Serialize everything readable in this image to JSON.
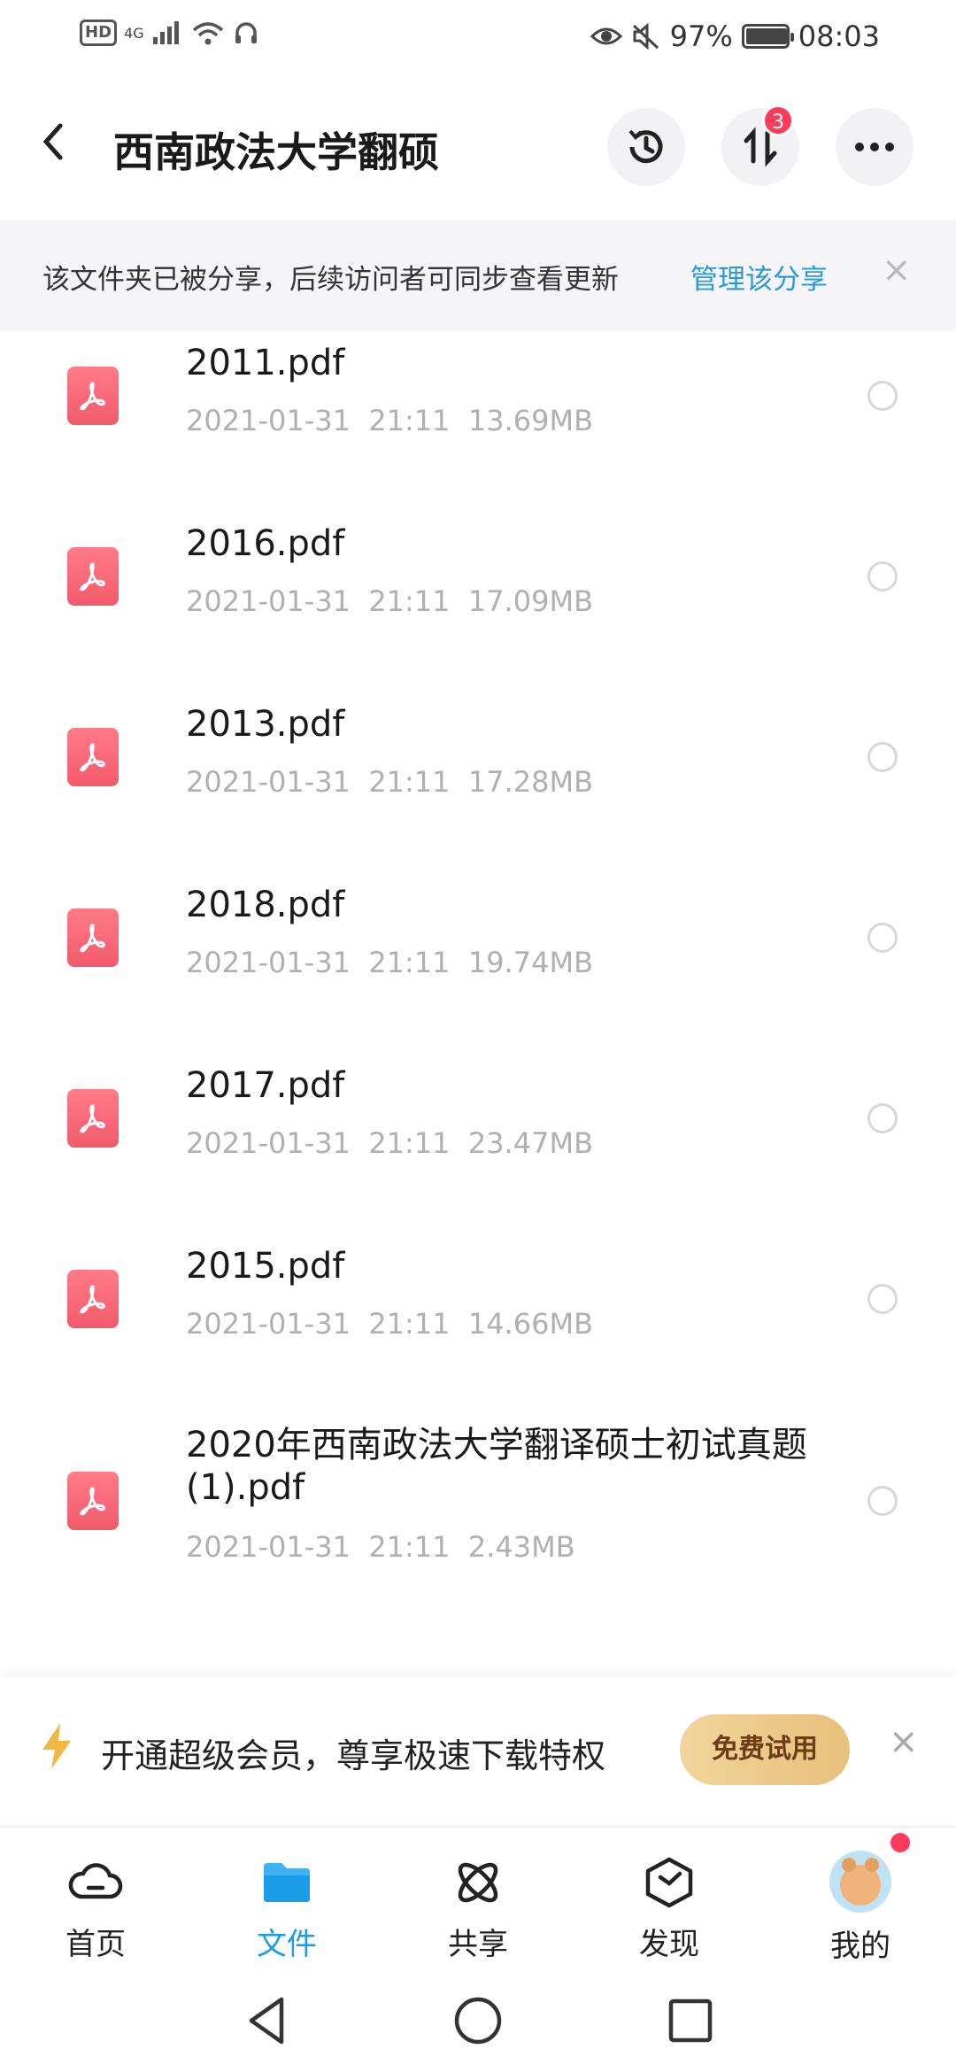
{
  "status_bar": {
    "left_badge": "HD",
    "network": "4G",
    "battery_text": "97%",
    "battery_level": 0.97,
    "time": "08:03"
  },
  "header": {
    "title": "西南政法大学翻硕",
    "transfer_badge": "3"
  },
  "notice": {
    "text": "该文件夹已被分享，后续访问者可同步查看更新",
    "link": "管理该分享",
    "close": "×"
  },
  "files": [
    {
      "name": "2011.pdf",
      "date": "2021-01-31",
      "time": "21:11",
      "size": "13.69MB"
    },
    {
      "name": "2016.pdf",
      "date": "2021-01-31",
      "time": "21:11",
      "size": "17.09MB"
    },
    {
      "name": "2013.pdf",
      "date": "2021-01-31",
      "time": "21:11",
      "size": "17.28MB"
    },
    {
      "name": "2018.pdf",
      "date": "2021-01-31",
      "time": "21:11",
      "size": "19.74MB"
    },
    {
      "name": "2017.pdf",
      "date": "2021-01-31",
      "time": "21:11",
      "size": "23.47MB"
    },
    {
      "name": "2015.pdf",
      "date": "2021-01-31",
      "time": "21:11",
      "size": "14.66MB"
    },
    {
      "name": "2020年西南政法大学翻译硕士初试真题(1).pdf",
      "date": "2021-01-31",
      "time": "21:11",
      "size": "2.43MB"
    }
  ],
  "vip_banner": {
    "text": "开通超级会员，尊享极速下载特权",
    "button": "免费试用",
    "close": "×"
  },
  "tabs": [
    {
      "label": "首页",
      "icon": "cloud-icon"
    },
    {
      "label": "文件",
      "icon": "folder-icon",
      "active": true
    },
    {
      "label": "共享",
      "icon": "atom-icon"
    },
    {
      "label": "发现",
      "icon": "cube-icon"
    },
    {
      "label": "我的",
      "icon": "avatar"
    }
  ],
  "colors": {
    "accent": "#1b9ce6",
    "pdf_red": "#f25a6b",
    "badge_red": "#ff3b5c",
    "vip_gold": "#e7c07b"
  }
}
